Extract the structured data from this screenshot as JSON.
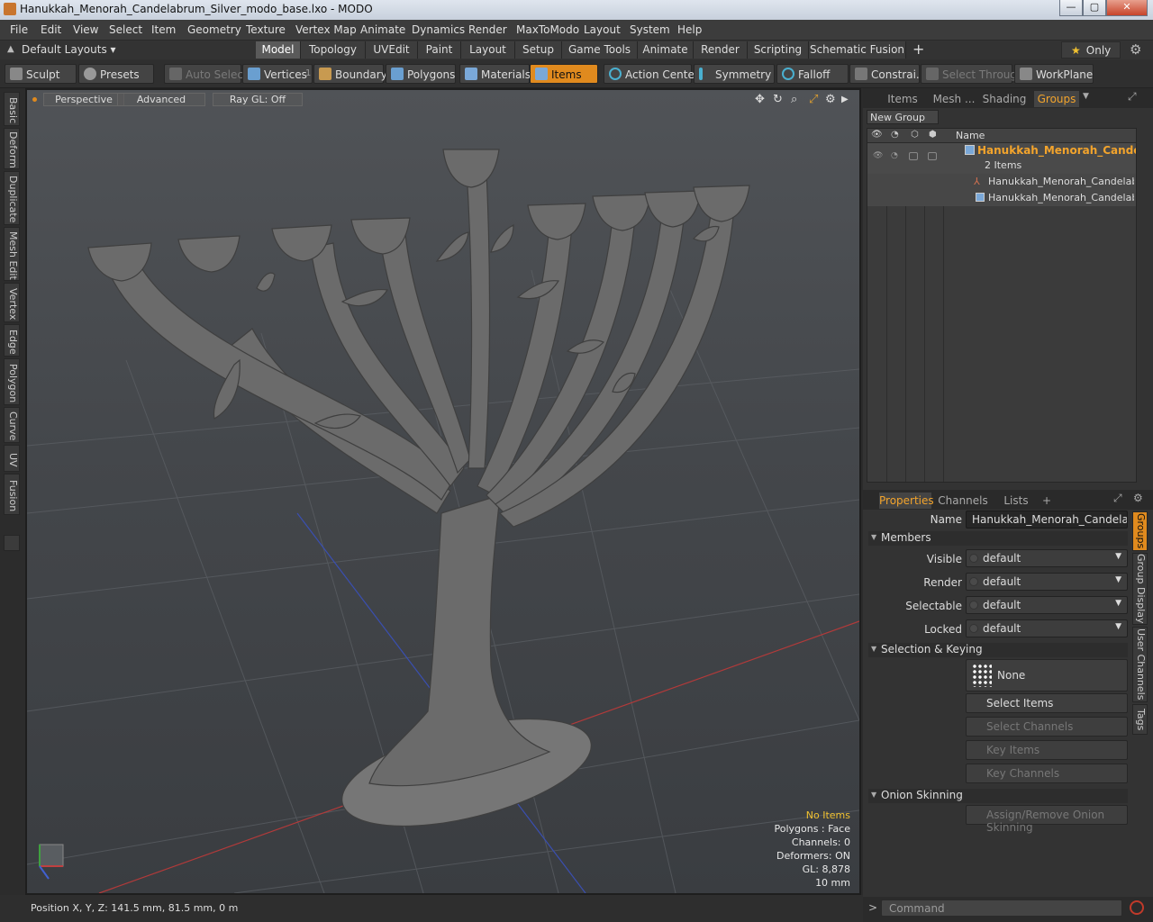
{
  "window": {
    "title": "Hanukkah_Menorah_Candelabrum_Silver_modo_base.lxo - MODO",
    "min_glyph": "—",
    "max_glyph": "▢",
    "close_glyph": "✕"
  },
  "menu": [
    "File",
    "Edit",
    "View",
    "Select",
    "Item",
    "Geometry",
    "Texture",
    "Vertex Map",
    "Animate",
    "Dynamics",
    "Render",
    "MaxToModo",
    "Layout",
    "System",
    "Help"
  ],
  "layouts": {
    "label": "Default Layouts ▾",
    "tabs": [
      "Model",
      "Topology",
      "UVEdit",
      "Paint",
      "Layout",
      "Setup",
      "Game Tools",
      "Animate",
      "Render",
      "Scripting",
      "Schematic Fusion"
    ],
    "active_tab": "Model",
    "add": "+",
    "only": "Only"
  },
  "toolbar": {
    "sculpt": "Sculpt",
    "presets": "Presets",
    "auto_select": "Auto Select",
    "vertices": "Vertices",
    "vertices_badge": "1",
    "boundary": "Boundary",
    "polygons": "Polygons",
    "materials": "Materials",
    "items": "Items",
    "action_center": "Action Center",
    "symmetry": "Symmetry",
    "falloff": "Falloff",
    "constraints": "Constrai...",
    "select_through": "Select Through",
    "workplane": "WorkPlane"
  },
  "left_tabs": [
    "Basic",
    "Deform",
    "Duplicate",
    "Mesh Edit",
    "Vertex",
    "Edge",
    "Polygon",
    "Curve",
    "UV",
    "Fusion"
  ],
  "viewport": {
    "view": "Perspective",
    "shading": "Advanced",
    "raygl": "Ray GL: Off",
    "info": {
      "selection": "No Items",
      "polygons": "Polygons : Face",
      "channels": "Channels: 0",
      "deformers": "Deformers: ON",
      "gl": "GL: 8,878",
      "scale": "10 mm"
    }
  },
  "status": {
    "position": "Position X, Y, Z:   141.5 mm, 81.5 mm, 0 m"
  },
  "groups_panel": {
    "tabs": [
      "Items",
      "Mesh ...",
      "Shading",
      "Groups"
    ],
    "active_tab": "Groups",
    "new_group": "New Group",
    "col_name": "Name",
    "group_name": "Hanukkah_Menorah_Candel...",
    "group_count": "2 Items",
    "children": [
      "Hanukkah_Menorah_Candelab ...",
      "Hanukkah_Menorah_Candelab ..."
    ]
  },
  "properties": {
    "tabs": [
      "Properties",
      "Channels",
      "Lists",
      "+"
    ],
    "name_label": "Name",
    "name_value": "Hanukkah_Menorah_Candelabrum_",
    "members_section": "Members",
    "visible_label": "Visible",
    "visible_value": "default",
    "render_label": "Render",
    "render_value": "default",
    "selectable_label": "Selectable",
    "selectable_value": "default",
    "locked_label": "Locked",
    "locked_value": "default",
    "selection_section": "Selection & Keying",
    "none_button": "None",
    "select_items": "Select Items",
    "select_channels": "Select Channels",
    "key_items": "Key Items",
    "key_channels": "Key Channels",
    "onion_section": "Onion Skinning",
    "onion_button": "Assign/Remove Onion Skinning",
    "side_tabs": [
      "Groups",
      "Group Display",
      "User Channels",
      "Tags"
    ]
  },
  "command": {
    "placeholder": "Command"
  }
}
